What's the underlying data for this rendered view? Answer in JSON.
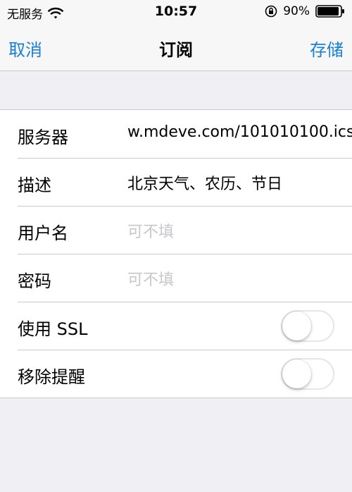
{
  "status_bar": {
    "carrier": "无服务",
    "time": "10:57",
    "battery_percent": "90%",
    "icons": [
      "wifi-icon",
      "orientation-lock-icon",
      "battery-icon"
    ]
  },
  "nav": {
    "cancel_label": "取消",
    "title": "订阅",
    "save_label": "存储",
    "accent_color": "#1a7fd3"
  },
  "form": {
    "rows": [
      {
        "label": "服务器",
        "value": "w.mdeve.com/101010100.ics",
        "placeholder": ""
      },
      {
        "label": "描述",
        "value": "北京天气、农历、节日",
        "placeholder": ""
      },
      {
        "label": "用户名",
        "value": "",
        "placeholder": "可不填"
      },
      {
        "label": "密码",
        "value": "",
        "placeholder": "可不填"
      }
    ],
    "toggles": [
      {
        "label": "使用 SSL",
        "on": false
      },
      {
        "label": "移除提醒",
        "on": false
      }
    ]
  }
}
